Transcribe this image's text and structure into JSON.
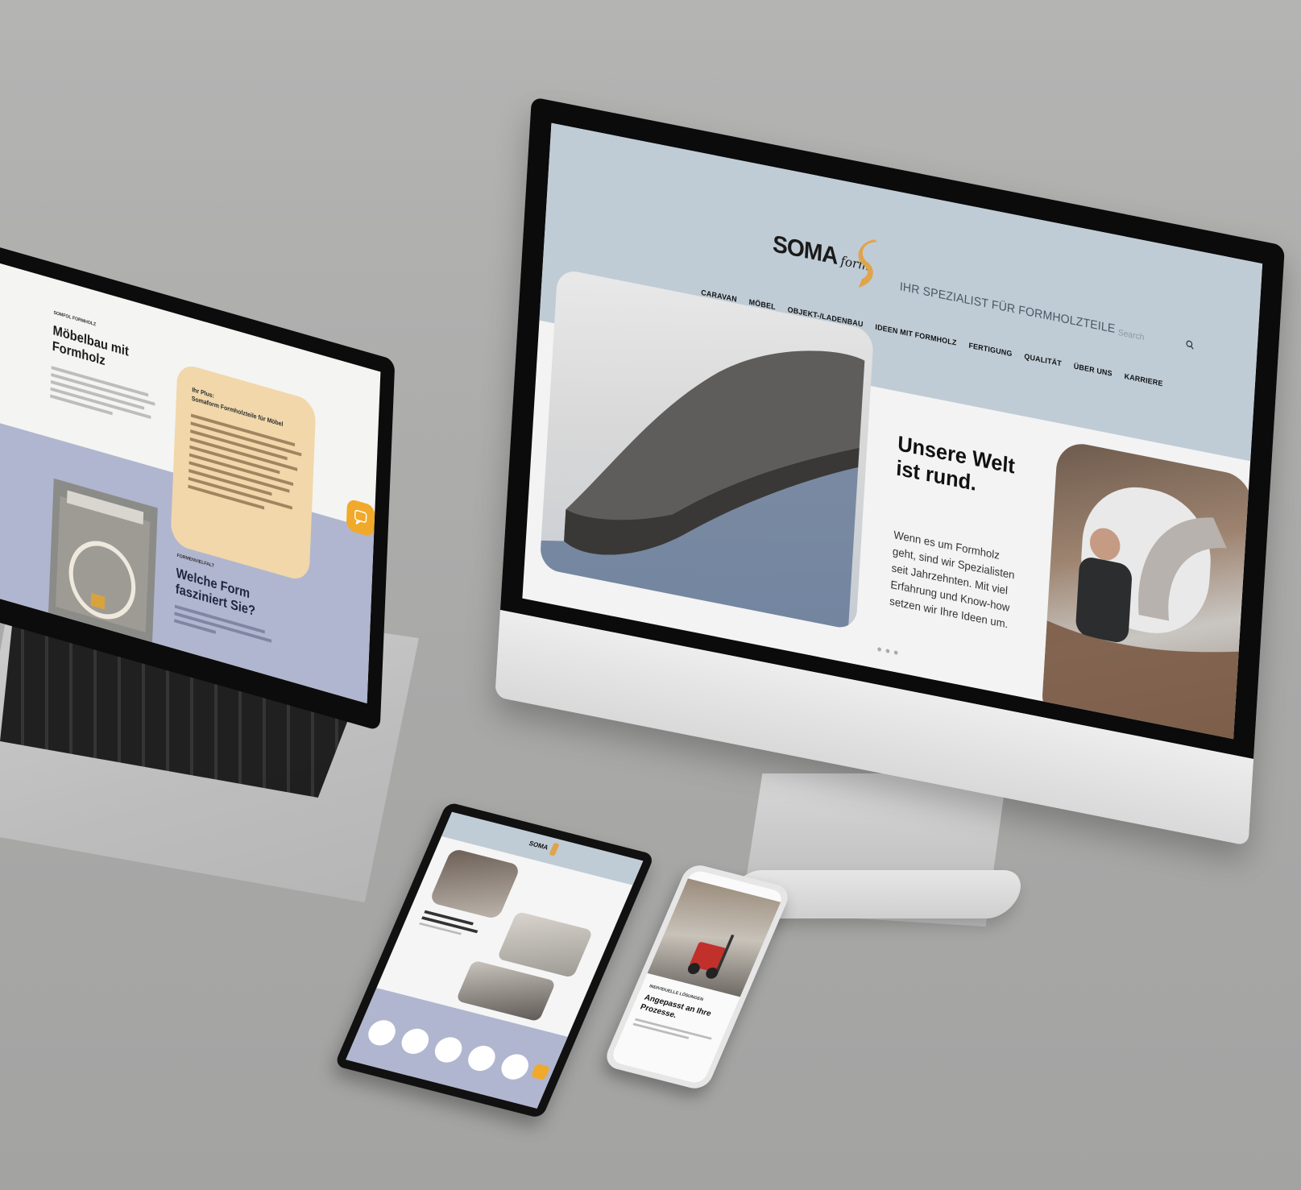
{
  "brand": {
    "name": "SOMA",
    "sub": "form",
    "tagline": "IHR SPEZIALIST FÜR FORMHOLZTEILE",
    "accent": "#e0a44a",
    "header_bg": "#bfccd6"
  },
  "search": {
    "placeholder": "Search"
  },
  "nav": [
    "CARAVAN",
    "MÖBEL",
    "OBJEKT-/LADENBAU",
    "IDEEN MIT FORMHOLZ",
    "FERTIGUNG",
    "QUALITÄT",
    "ÜBER UNS",
    "KARRIERE"
  ],
  "hero": {
    "title_line1": "Unsere Welt",
    "title_line2": "ist rund.",
    "text_line1": "Wenn es um Formholz",
    "text_line2": "geht, sind wir Spezialisten",
    "text_line3": "seit Jahrzehnten. Mit viel",
    "text_line4": "Erfahrung und Know-how",
    "text_line5": "setzen wir Ihre Ideen um.",
    "slides_count": 3
  },
  "laptop": {
    "kicker": "SOMFOL FORMHOLZ",
    "title_line1": "Möbelbau mit",
    "title_line2": "Formholz",
    "card_title_line1": "Ihr Plus:",
    "card_title_line2": "Somaform Formholzteile für Möbel",
    "kicker2": "FORMENVIELFALT",
    "title2_line1": "Welche Form",
    "title2_line2": "fasziniert Sie?"
  },
  "phone": {
    "kicker": "INDIVIDUELLE LÖSUNGEN",
    "title_line1": "Angepasst an Ihre",
    "title_line2": "Prozesse."
  },
  "colors": {
    "peach": "#f1d7aa",
    "lilac": "#b0b6cf",
    "orange": "#f0a92a"
  }
}
